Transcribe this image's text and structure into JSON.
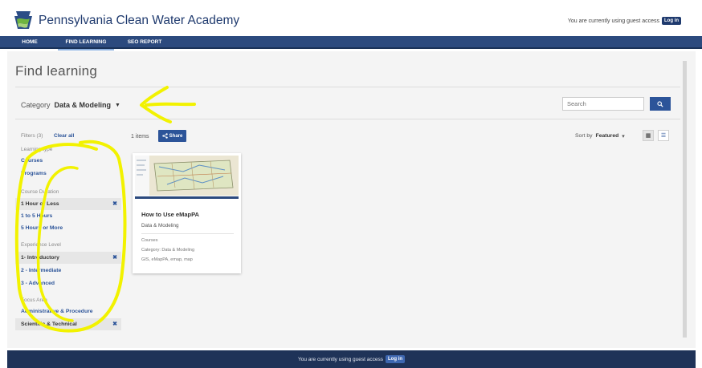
{
  "header": {
    "site_title": "Pennsylvania Clean Water Academy",
    "guest_text": "You are currently using guest access",
    "login_label": "Log in"
  },
  "nav": {
    "items": [
      {
        "label": "HOME",
        "active": false
      },
      {
        "label": "FIND LEARNING",
        "active": true
      },
      {
        "label": "SEO REPORT",
        "active": false
      }
    ]
  },
  "main": {
    "page_title": "Find learning",
    "category_label": "Category",
    "category_value": "Data & Modeling",
    "search_placeholder": "Search"
  },
  "filters": {
    "label": "Filters (3)",
    "clear_all": "Clear all",
    "sections": [
      {
        "title": "Learning type",
        "items": [
          {
            "label": "Courses",
            "selected": false
          },
          {
            "label": "Programs",
            "selected": false
          }
        ]
      },
      {
        "title": "Course Duration",
        "items": [
          {
            "label": "1 Hour or Less",
            "selected": true
          },
          {
            "label": "1 to 5 Hours",
            "selected": false
          },
          {
            "label": "5 Hours or More",
            "selected": false
          }
        ]
      },
      {
        "title": "Experience Level",
        "items": [
          {
            "label": "1- Introductory",
            "selected": true
          },
          {
            "label": "2 - Intermediate",
            "selected": false
          },
          {
            "label": "3 - Advanced",
            "selected": false
          }
        ]
      },
      {
        "title": "Focus Area",
        "items": [
          {
            "label": "Administrative & Procedure",
            "selected": false
          },
          {
            "label": "Scientific & Technical",
            "selected": true
          }
        ]
      }
    ],
    "remove_symbol": "✖"
  },
  "results": {
    "count": "1 items",
    "share_label": "Share",
    "sort_label": "Sort by",
    "sort_value": "Featured"
  },
  "card": {
    "title": "How to Use eMapPA",
    "subtitle": "Data & Modeling",
    "type": "Courses",
    "category": "Category: Data & Modeling",
    "tags": "GIS, eMapPA, emap, map"
  },
  "footer": {
    "guest_text": "You are currently using guest access",
    "login_label": "Log in"
  },
  "colors": {
    "brand_navy": "#1f3a6e",
    "nav_bar": "#2c4a7e",
    "link_blue": "#2c5499",
    "highlighter_yellow": "#f2f200"
  },
  "icons": {
    "logo": "pa-keystone-logo-icon",
    "search": "search-icon",
    "share": "share-icon",
    "caret": "caret-down-icon",
    "remove": "close-x-icon",
    "grid_view": "grid-view-icon",
    "list_view": "list-view-icon"
  }
}
